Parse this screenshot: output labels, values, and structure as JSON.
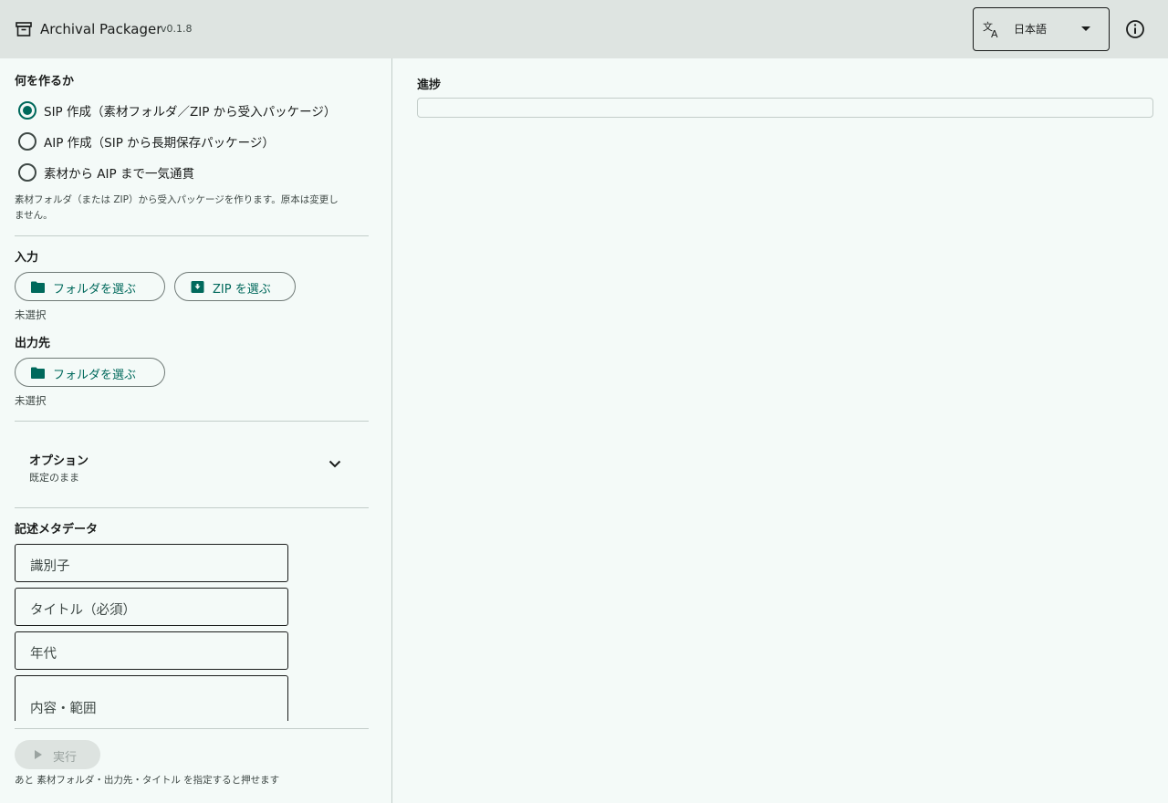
{
  "header": {
    "app_title": "Archival Packager",
    "version": "v0.1.8",
    "app_icon": "archive-box-icon",
    "language": {
      "selected": "日本語",
      "icon": "translate-icon"
    },
    "info_icon": "info-icon"
  },
  "mode": {
    "label": "何を作るか",
    "options": [
      {
        "label": "SIP 作成（素材フォルダ／ZIP から受入パッケージ）",
        "checked": true
      },
      {
        "label": "AIP 作成（SIP から長期保存パッケージ）",
        "checked": false
      },
      {
        "label": "素材から AIP まで一気通貫",
        "checked": false
      }
    ],
    "help_line1": "素材フォルダ（または ZIP）から受入パッケージを作ります。原本は変更し",
    "help_line2": "ません。"
  },
  "input": {
    "label": "入力",
    "folder_button": "フォルダを選ぶ",
    "zip_button": "ZIP を選ぶ",
    "status": "未選択"
  },
  "output": {
    "label": "出力先",
    "folder_button": "フォルダを選ぶ",
    "status": "未選択"
  },
  "options": {
    "title": "オプション",
    "subtitle": "既定のまま"
  },
  "metadata": {
    "label": "記述メタデータ",
    "fields": [
      {
        "placeholder": "識別子"
      },
      {
        "placeholder": "タイトル（必須）"
      },
      {
        "placeholder": "年代"
      },
      {
        "placeholder": "内容・範囲"
      }
    ]
  },
  "run": {
    "label": "実行",
    "enabled": false,
    "hint": "あと 素材フォルダ・出力先・タイトル を指定すると押せます"
  },
  "progress": {
    "label": "進捗",
    "value": 0
  },
  "colors": {
    "accent": "#00695c",
    "header_bg": "#dee4e1",
    "page_bg": "#f4faf8"
  }
}
